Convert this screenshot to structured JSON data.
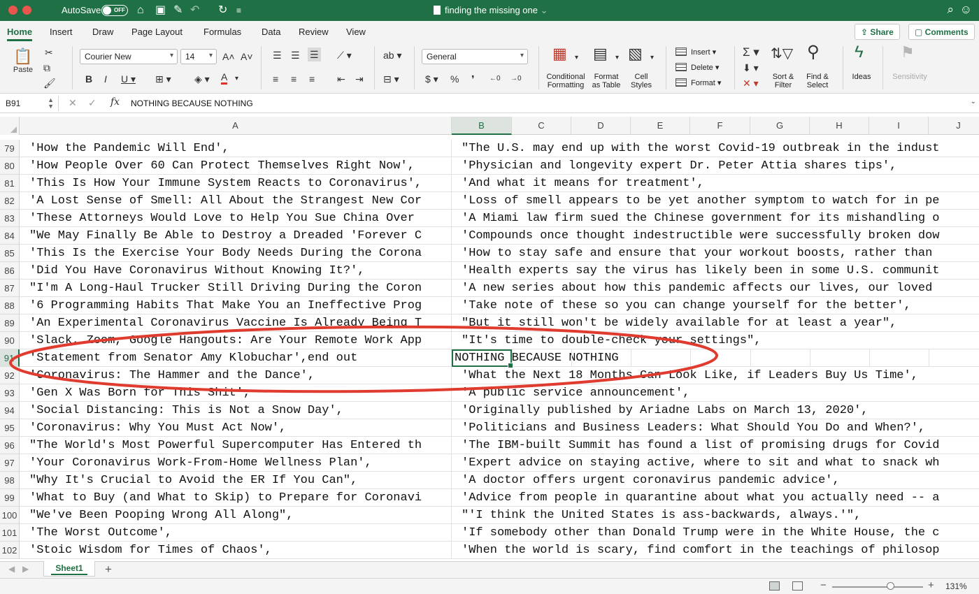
{
  "titlebar": {
    "autosave_label": "AutoSave",
    "autosave_state": "OFF",
    "doc_title": "finding the missing one",
    "doc_title_chevron": "⌄"
  },
  "ribbon_tabs": [
    "Home",
    "Insert",
    "Draw",
    "Page Layout",
    "Formulas",
    "Data",
    "Review",
    "View"
  ],
  "active_tab": "Home",
  "share_label": "Share",
  "comments_label": "Comments",
  "ribbon": {
    "paste": "Paste",
    "font_name": "Courier New",
    "font_size": "14",
    "number_format": "General",
    "conditional_formatting": [
      "Conditional",
      "Formatting"
    ],
    "format_as_table": [
      "Format",
      "as Table"
    ],
    "cell_styles": [
      "Cell",
      "Styles"
    ],
    "insert": "Insert",
    "delete": "Delete",
    "format": "Format",
    "sort_filter": [
      "Sort &",
      "Filter"
    ],
    "find_select": [
      "Find &",
      "Select"
    ],
    "ideas": "Ideas",
    "sensitivity": "Sensitivity"
  },
  "formula_bar": {
    "name_box": "B91",
    "fx": "fx",
    "content": "NOTHING BECAUSE NOTHING"
  },
  "columns": [
    "A",
    "B",
    "C",
    "D",
    "E",
    "F",
    "G",
    "H",
    "I",
    "J"
  ],
  "selected_column": "B",
  "rows": [
    {
      "n": "79",
      "a": "'How the Pandemic Will End',",
      "b": "\"The U.S. may end up with the worst Covid-19 outbreak in the indust"
    },
    {
      "n": "80",
      "a": "'How People Over 60 Can Protect Themselves Right Now',",
      "b": "'Physician and longevity expert Dr. Peter Attia shares tips',"
    },
    {
      "n": "81",
      "a": "'This Is How Your Immune System Reacts to Coronavirus',",
      "b": "'And what it means for treatment',"
    },
    {
      "n": "82",
      "a": "'A Lost Sense of Smell: All About the Strangest New Cor",
      "b": "'Loss of smell appears to be yet another symptom to watch for in pe"
    },
    {
      "n": "83",
      "a": "'These Attorneys Would Love to Help You Sue China Over",
      "b": "'A Miami law firm sued the Chinese government for its mishandling o"
    },
    {
      "n": "84",
      "a": "\"We May Finally Be Able to Destroy a Dreaded 'Forever C",
      "b": "'Compounds once thought indestructible were successfully broken dow"
    },
    {
      "n": "85",
      "a": "'This Is the Exercise Your Body Needs During the Corona",
      "b": "'How to stay safe and ensure that your workout boosts, rather than"
    },
    {
      "n": "86",
      "a": "'Did You Have Coronavirus Without Knowing It?',",
      "b": "'Health experts say the virus has likely been in some U.S. communit"
    },
    {
      "n": "87",
      "a": "\"I'm A Long-Haul Trucker Still Driving During the Coron",
      "b": "'A new series about how this pandemic affects our lives, our loved"
    },
    {
      "n": "88",
      "a": "'6 Programming Habits That Make You an Ineffective Prog",
      "b": "'Take note of these so you can change yourself for the better',"
    },
    {
      "n": "89",
      "a": "'An Experimental Coronavirus Vaccine Is Already Being T",
      "b": "\"But it still won't be widely available for at least a year\","
    },
    {
      "n": "90",
      "a": "'Slack, Zoom, Google Hangouts: Are Your Remote Work App",
      "b": "\"It's time to double-check your settings\","
    },
    {
      "n": "91",
      "a": "'Statement from Senator Amy Klobuchar',end out",
      "b": "NOTHING BECAUSE NOTHING"
    },
    {
      "n": "92",
      "a": "'Coronavirus: The Hammer and the Dance',",
      "b": "'What the Next 18 Months Can Look Like, if Leaders Buy Us Time',"
    },
    {
      "n": "93",
      "a": "'Gen X Was Born for This Shit',",
      "b": "'A public service announcement',"
    },
    {
      "n": "94",
      "a": "'Social Distancing: This is Not a Snow Day',",
      "b": "'Originally published by Ariadne Labs on March 13, 2020',"
    },
    {
      "n": "95",
      "a": "'Coronavirus: Why You Must Act Now',",
      "b": "'Politicians and Business Leaders: What Should You Do and When?',"
    },
    {
      "n": "96",
      "a": "\"The World's Most Powerful Supercomputer Has Entered th",
      "b": "'The IBM-built Summit has found a list of promising drugs for Covid"
    },
    {
      "n": "97",
      "a": "'Your Coronavirus Work-From-Home Wellness Plan',",
      "b": "'Expert advice on staying active, where to sit and what to snack wh"
    },
    {
      "n": "98",
      "a": "\"Why It's Crucial to Avoid the ER If You Can\",",
      "b": "'A doctor offers urgent coronavirus pandemic advice',"
    },
    {
      "n": "99",
      "a": "'What to Buy (and What to Skip) to Prepare for Coronavi",
      "b": "'Advice from people in quarantine about what you actually need -- a"
    },
    {
      "n": "100",
      "a": "\"We've Been Pooping Wrong All Along\",",
      "b": "\"'I think the United States is ass-backwards, always.'\","
    },
    {
      "n": "101",
      "a": "'The Worst Outcome',",
      "b": "'If somebody other than Donald Trump were in the White House, the c"
    },
    {
      "n": "102",
      "a": "'Stoic Wisdom for Times of Chaos',",
      "b": "'When the world is scary, find comfort in the teachings of philosop"
    }
  ],
  "selected_row": "91",
  "sheet_tab": "Sheet1",
  "add_sheet": "+",
  "zoom_level": "131%",
  "colors": {
    "accent": "#1f7145",
    "annotation": "#e03b2f"
  }
}
